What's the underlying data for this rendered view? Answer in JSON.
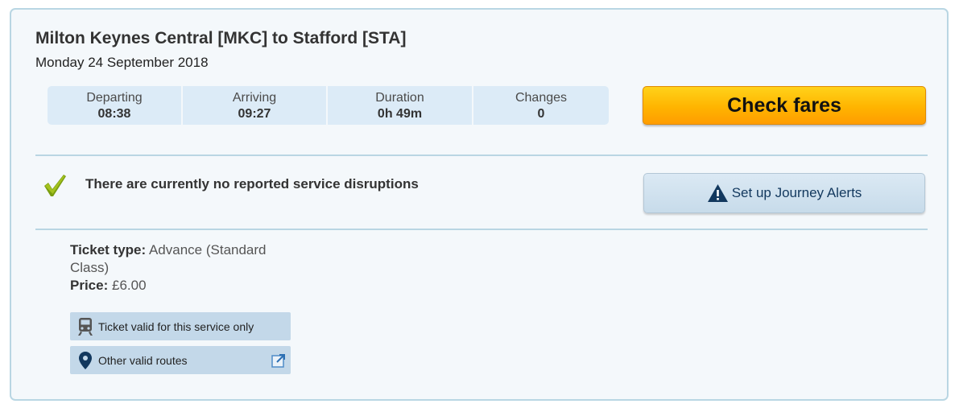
{
  "journey": {
    "title": "Milton Keynes Central [MKC] to Stafford [STA]",
    "date": "Monday 24 September 2018"
  },
  "stats": [
    {
      "label": "Departing",
      "value": "08:38"
    },
    {
      "label": "Arriving",
      "value": "09:27"
    },
    {
      "label": "Duration",
      "value": "0h 49m"
    },
    {
      "label": "Changes",
      "value": "0"
    }
  ],
  "actions": {
    "check_fares_label": "Check fares",
    "journey_alerts_label": "Set up Journey Alerts"
  },
  "disruption": {
    "message": "There are currently no reported service disruptions",
    "icon": "checkmark-icon"
  },
  "ticket": {
    "type_label": "Ticket type:",
    "type_value": "Advance (Standard Class)",
    "price_label": "Price:",
    "price_value": "£6.00"
  },
  "info_links": [
    {
      "label": "Ticket valid for this service only",
      "icon": "train-icon"
    },
    {
      "label": "Other valid routes",
      "icon": "map-pin-icon",
      "trailing_icon": "external-link-icon"
    }
  ],
  "colors": {
    "accent": "#ffb400",
    "border": "#b9d6e3",
    "stat_bg": "#dcebf7",
    "check_green": "#7a9e0f",
    "alert_navy": "#12385e"
  }
}
